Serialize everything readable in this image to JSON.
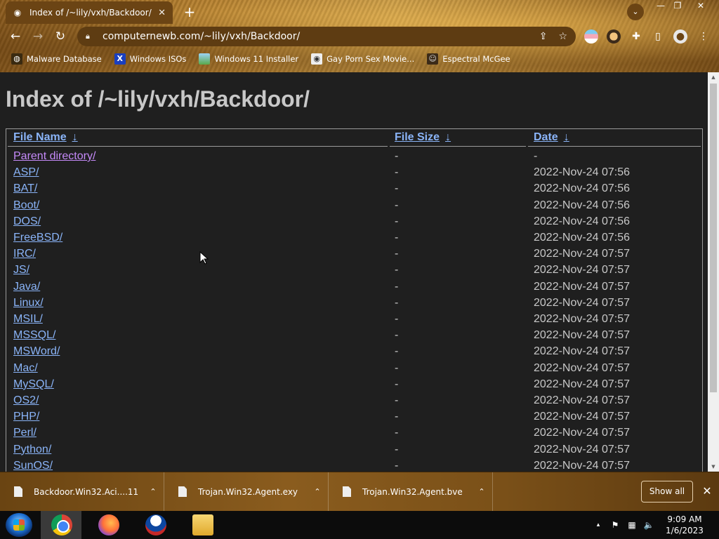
{
  "browser": {
    "tab": {
      "title": "Index of /~lily/vxh/Backdoor/",
      "close": "✕"
    },
    "new_tab": "+",
    "window_controls": {
      "minimize": "—",
      "restore": "❐",
      "close": "✕"
    },
    "tab_search": "⌄",
    "nav": {
      "back": "←",
      "forward": "→",
      "reload": "↻"
    },
    "address": {
      "url": "computernewb.com/~lily/vxh/Backdoor/",
      "share": "⇪",
      "star": "☆"
    },
    "toolbar": {
      "extensions": "✚",
      "sidepanel": "▯",
      "profile": "●",
      "menu": "⋮"
    },
    "bookmarks": [
      {
        "label": "Malware Database",
        "icon": "globe-icon"
      },
      {
        "label": "Windows ISOs",
        "icon": "x-logo-icon"
      },
      {
        "label": "Windows 11 Installer",
        "icon": "image-icon"
      },
      {
        "label": "Gay Porn Sex Movie...",
        "icon": "favicon-icon"
      },
      {
        "label": "Espectral McGee",
        "icon": "ghost-icon"
      }
    ]
  },
  "page": {
    "heading": "Index of /~lily/vxh/Backdoor/",
    "columns": {
      "name": "File Name",
      "size": "File Size",
      "date": "Date",
      "sort_glyph": "↓"
    },
    "rows": [
      {
        "name": "Parent directory/",
        "size": "-",
        "date": "-",
        "visited": true
      },
      {
        "name": "ASP/",
        "size": "-",
        "date": "2022-Nov-24 07:56"
      },
      {
        "name": "BAT/",
        "size": "-",
        "date": "2022-Nov-24 07:56"
      },
      {
        "name": "Boot/",
        "size": "-",
        "date": "2022-Nov-24 07:56"
      },
      {
        "name": "DOS/",
        "size": "-",
        "date": "2022-Nov-24 07:56"
      },
      {
        "name": "FreeBSD/",
        "size": "-",
        "date": "2022-Nov-24 07:56"
      },
      {
        "name": "IRC/",
        "size": "-",
        "date": "2022-Nov-24 07:57"
      },
      {
        "name": "JS/",
        "size": "-",
        "date": "2022-Nov-24 07:57"
      },
      {
        "name": "Java/",
        "size": "-",
        "date": "2022-Nov-24 07:57"
      },
      {
        "name": "Linux/",
        "size": "-",
        "date": "2022-Nov-24 07:57"
      },
      {
        "name": "MSIL/",
        "size": "-",
        "date": "2022-Nov-24 07:57"
      },
      {
        "name": "MSSQL/",
        "size": "-",
        "date": "2022-Nov-24 07:57"
      },
      {
        "name": "MSWord/",
        "size": "-",
        "date": "2022-Nov-24 07:57"
      },
      {
        "name": "Mac/",
        "size": "-",
        "date": "2022-Nov-24 07:57"
      },
      {
        "name": "MySQL/",
        "size": "-",
        "date": "2022-Nov-24 07:57"
      },
      {
        "name": "OS2/",
        "size": "-",
        "date": "2022-Nov-24 07:57"
      },
      {
        "name": "PHP/",
        "size": "-",
        "date": "2022-Nov-24 07:57"
      },
      {
        "name": "Perl/",
        "size": "-",
        "date": "2022-Nov-24 07:57"
      },
      {
        "name": "Python/",
        "size": "-",
        "date": "2022-Nov-24 07:57"
      },
      {
        "name": "SunOS/",
        "size": "-",
        "date": "2022-Nov-24 07:57"
      }
    ]
  },
  "downloads": {
    "items": [
      {
        "name": "Backdoor.Win32.Aci....11"
      },
      {
        "name": "Trojan.Win32.Agent.exy"
      },
      {
        "name": "Trojan.Win32.Agent.bve"
      }
    ],
    "chevron": "⌃",
    "show_all": "Show all",
    "close": "✕"
  },
  "taskbar": {
    "apps": [
      "chrome-icon",
      "firefox-icon",
      "obama-logo-icon",
      "file-explorer-icon"
    ],
    "tray": {
      "show_hidden": "▴",
      "flag": "⚑",
      "network": "▦",
      "volume": "🔈"
    },
    "time": "9:09 AM",
    "date": "1/6/2023"
  },
  "colors": {
    "link": "#8ab4f8",
    "visited": "#c58af9",
    "page_bg": "#1f1f1f",
    "text": "#c8c8c8"
  }
}
